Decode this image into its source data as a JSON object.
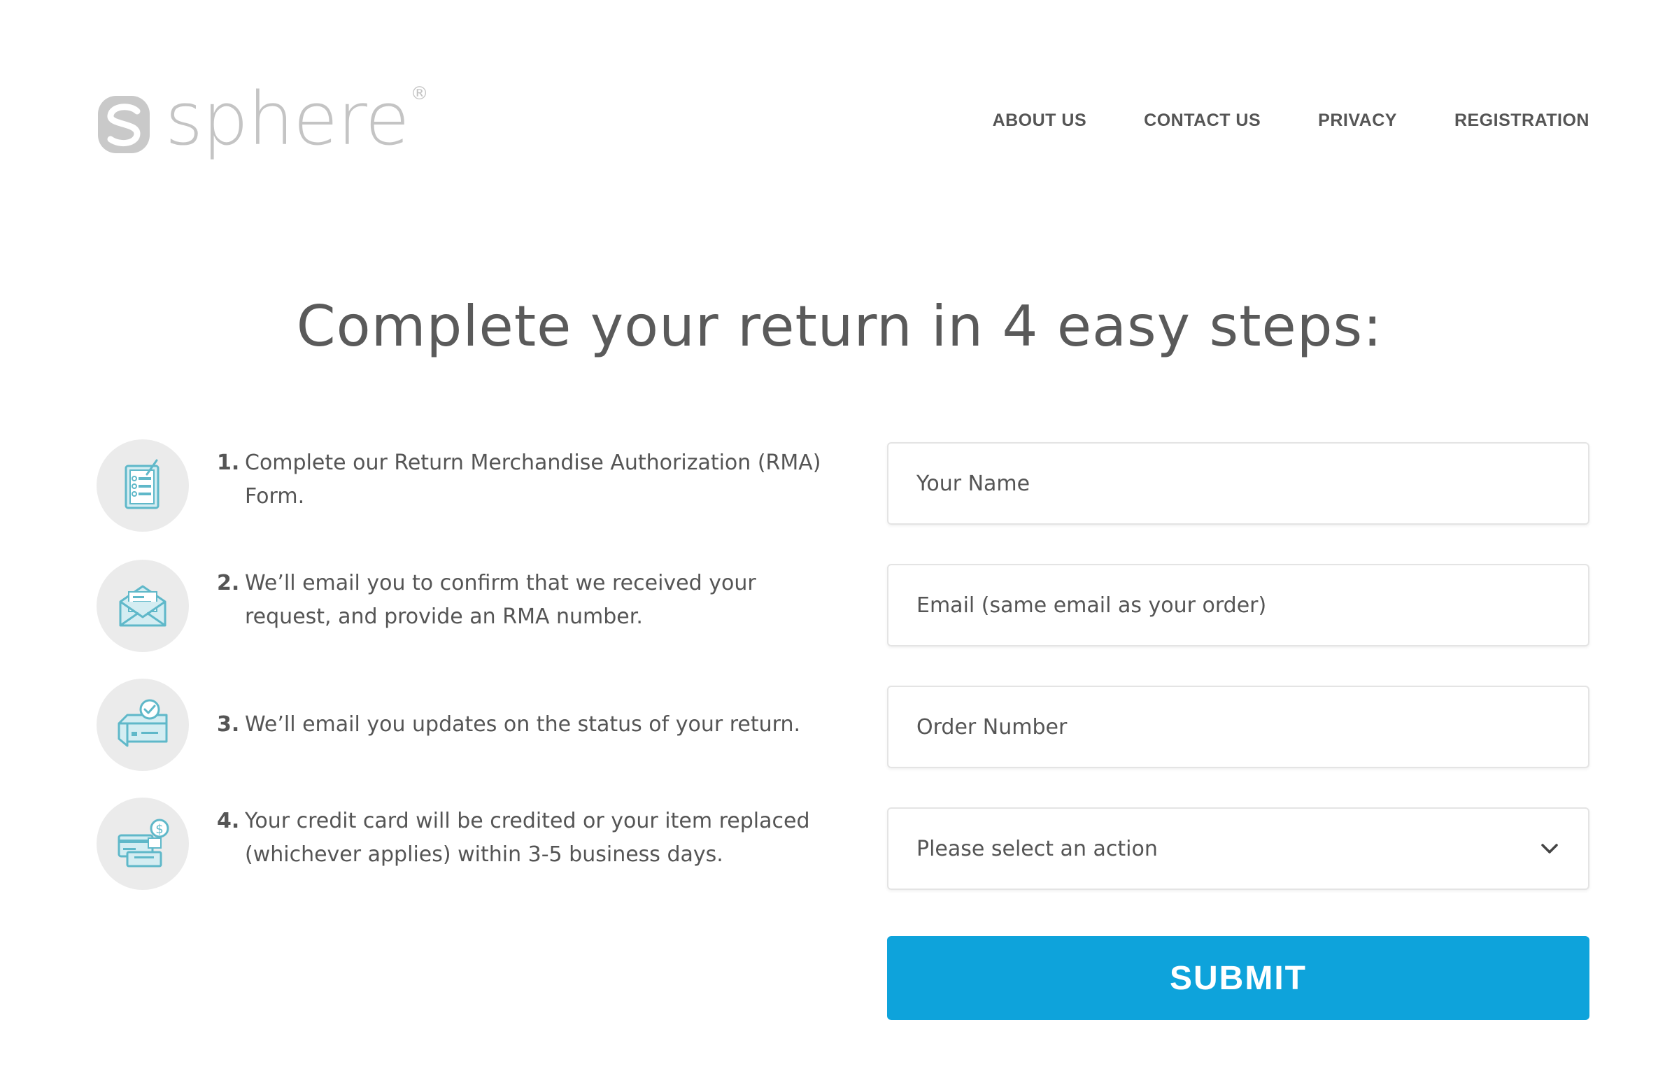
{
  "header": {
    "logo_text": "sphere",
    "logo_reg": "®",
    "nav": [
      {
        "label": "ABOUT US"
      },
      {
        "label": "CONTACT US"
      },
      {
        "label": "PRIVACY"
      },
      {
        "label": "REGISTRATION"
      }
    ]
  },
  "main": {
    "title": "Complete your return in 4 easy steps:",
    "steps": [
      {
        "number": "1.",
        "text": "Complete our Return Merchandise Authorization (RMA) Form.",
        "icon": "form-checklist-icon"
      },
      {
        "number": "2.",
        "text": "We’ll email you to confirm that we received your request, and provide an RMA number.",
        "icon": "envelope-icon"
      },
      {
        "number": "3.",
        "text": "We’ll email you updates on the status of your return.",
        "icon": "box-check-icon"
      },
      {
        "number": "4.",
        "text": "Your credit card will be credited or your item replaced (whichever applies) within 3-5 business days.",
        "icon": "credit-card-dollar-icon"
      }
    ]
  },
  "form": {
    "name_placeholder": "Your Name",
    "email_placeholder": "Email (same email as your order)",
    "order_placeholder": "Order Number",
    "action_select": "Please select an action",
    "submit_label": "SUBMIT"
  },
  "colors": {
    "accent": "#0ea3db",
    "icon_teal": "#5fb8c9",
    "icon_fill": "#d4edf2",
    "text": "#555555",
    "logo_gray": "#c4c4c4",
    "circle_bg": "#ebebeb"
  }
}
